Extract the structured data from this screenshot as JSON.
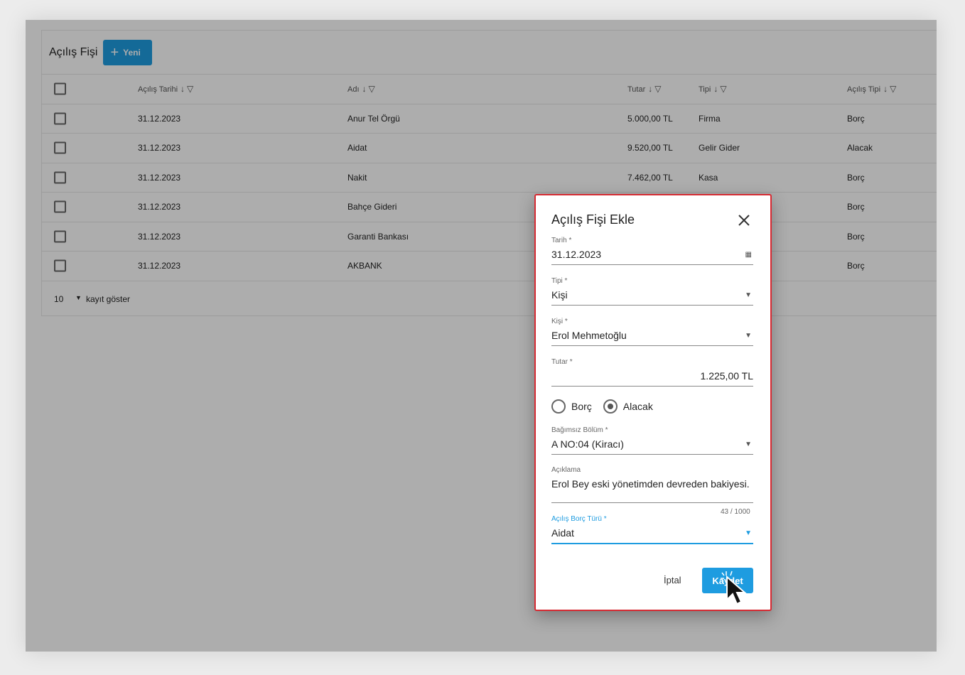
{
  "page": {
    "title": "Açılış Fişi",
    "new_button": "Yeni"
  },
  "table": {
    "columns": [
      "Açılış Tarihi",
      "Adı",
      "Tutar",
      "Tipi",
      "Açılış Tipi"
    ],
    "rows": [
      {
        "date": "31.12.2023",
        "name": "Anur Tel Örgü",
        "amount": "5.000,00 TL",
        "type": "Firma",
        "opening_type": "Borç"
      },
      {
        "date": "31.12.2023",
        "name": "Aidat",
        "amount": "9.520,00 TL",
        "type": "Gelir Gider",
        "opening_type": "Alacak"
      },
      {
        "date": "31.12.2023",
        "name": "Nakit",
        "amount": "7.462,00 TL",
        "type": "Kasa",
        "opening_type": "Borç"
      },
      {
        "date": "31.12.2023",
        "name": "Bahçe Gideri",
        "amount": "",
        "type": "",
        "opening_type": "Borç"
      },
      {
        "date": "31.12.2023",
        "name": "Garanti Bankası",
        "amount": "",
        "type": "",
        "opening_type": "Borç"
      },
      {
        "date": "31.12.2023",
        "name": "AKBANK",
        "amount": "",
        "type": "",
        "opening_type": "Borç"
      }
    ],
    "footer": {
      "page_size": "10",
      "page_size_label": "kayıt göster"
    }
  },
  "dialog": {
    "title": "Açılış Fişi Ekle",
    "fields": {
      "date": {
        "label": "Tarih *",
        "value": "31.12.2023"
      },
      "type": {
        "label": "Tipi *",
        "value": "Kişi"
      },
      "person": {
        "label": "Kişi *",
        "value": "Erol Mehmetoğlu"
      },
      "amount": {
        "label": "Tutar *",
        "value": "1.225,00 TL"
      },
      "unit": {
        "label": "Bağımsız Bölüm *",
        "value": "A NO:04 (Kiracı)"
      },
      "description": {
        "label": "Açıklama",
        "value": "Erol Bey eski yönetimden devreden bakiyesi.",
        "counter": "43 / 1000"
      },
      "debt_type": {
        "label": "Açılış Borç Türü *",
        "value": "Aidat"
      }
    },
    "radio": {
      "borc": "Borç",
      "alacak": "Alacak",
      "selected": "alacak"
    },
    "cancel": "İptal",
    "save": "Kaydet"
  },
  "colors": {
    "accent": "#1e9ce0",
    "dialog_border": "#d62a32"
  },
  "icons": [
    "plus-icon",
    "sort-down-icon",
    "filter-icon",
    "close-icon",
    "calendar-icon",
    "dropdown-arrow-icon",
    "cursor-icon"
  ]
}
